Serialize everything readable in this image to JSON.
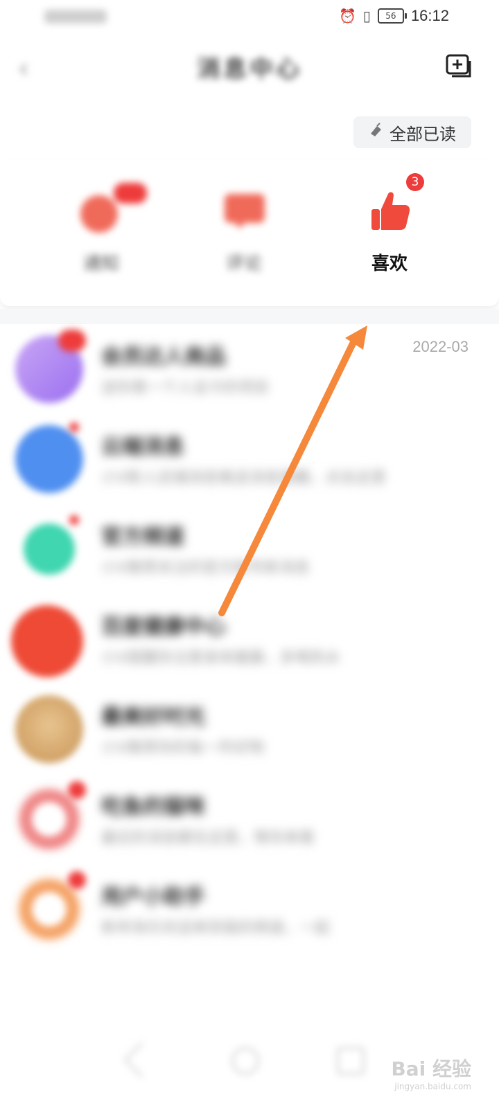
{
  "status_bar": {
    "time": "16:12",
    "battery": "56"
  },
  "header": {
    "title": "消息中心"
  },
  "actions": {
    "mark_all_read": "全部已读"
  },
  "categories": [
    {
      "label": "通知",
      "badge": ""
    },
    {
      "label": "评论",
      "badge": ""
    },
    {
      "label": "喜欢",
      "badge": "3"
    }
  ],
  "messages": [
    {
      "name": "会员达人商品",
      "preview": "送你第一个人设卡的项目",
      "time": "2022-03"
    },
    {
      "name": "云端消息",
      "preview": "小V新人店铺消息推送消息提醒，点击这里",
      "time": ""
    },
    {
      "name": "官方频道",
      "preview": "小V推荐关注的官方账号新消息",
      "time": ""
    },
    {
      "name": "百度健康中心",
      "preview": "小V提醒你注意身体健康，多喝热水",
      "time": ""
    },
    {
      "name": "最美好时光",
      "preview": "小V推荐你的每一件好物",
      "time": ""
    },
    {
      "name": "吃鱼的猫咪",
      "preview": "最近的消息都在这里，等你来看",
      "time": ""
    },
    {
      "name": "用户小助手",
      "preview": "新年快乐欢迎来到我的频道，一起",
      "time": ""
    }
  ],
  "watermark": {
    "brand": "Bai 经验",
    "url": "jingyan.baidu.com"
  },
  "colors": {
    "accent_red": "#ee3b3b",
    "arrow": "#f5883a"
  }
}
